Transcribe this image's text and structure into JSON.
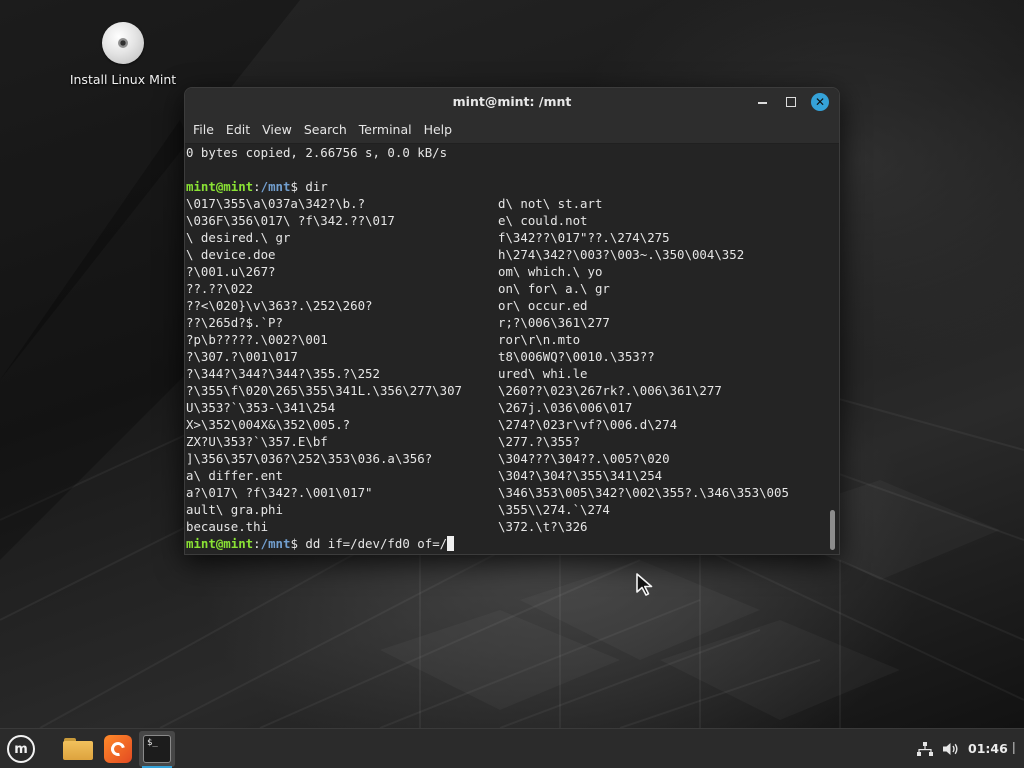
{
  "desktop": {
    "icons": [
      {
        "label": "Install Linux Mint",
        "icon": "disc-icon"
      }
    ]
  },
  "terminal": {
    "title": "mint@mint: /mnt",
    "window_buttons": {
      "minimize": "–",
      "maximize": "□",
      "close": "✕"
    },
    "menu": [
      "File",
      "Edit",
      "View",
      "Search",
      "Terminal",
      "Help"
    ],
    "first_line": "0 bytes copied, 2.66756 s, 0.0 kB/s",
    "prompt": {
      "user": "mint@mint",
      "sep": ":",
      "path": "/mnt",
      "symbol": "$ "
    },
    "dir_command": "dir",
    "listing": [
      [
        "\\017\\355\\a\\037a\\342?\\b.?",
        "d\\ not\\ st.art"
      ],
      [
        "\\036F\\356\\017\\ ?f\\342.??\\017",
        "e\\ could.not"
      ],
      [
        "\\ desired.\\ gr",
        "f\\342??\\017\"??.\\274\\275"
      ],
      [
        "\\ device.doe",
        "h\\274\\342?\\003?\\003~.\\350\\004\\352"
      ],
      [
        "?\\001.u\\267?",
        "om\\ which.\\ yo"
      ],
      [
        "??.??\\022",
        "on\\ for\\ a.\\ gr"
      ],
      [
        "??<\\020}\\v\\363?.\\252\\260?",
        "or\\ occur.ed"
      ],
      [
        "??\\265d?$.`P?",
        "r;?\\006\\361\\277"
      ],
      [
        "?p\\b?????.\\002?\\001",
        "ror\\r\\n.mto"
      ],
      [
        "?\\307.?\\001\\017",
        "t8\\006WQ?\\0010.\\353??"
      ],
      [
        "?\\344?\\344?\\344?\\355.?\\252",
        "ured\\ whi.le"
      ],
      [
        "?\\355\\f\\020\\265\\355\\341L.\\356\\277\\307",
        "\\260??\\023\\267rk?.\\006\\361\\277"
      ],
      [
        "U\\353?`\\353-\\341\\254",
        "\\267j.\\036\\006\\017"
      ],
      [
        "X>\\352\\004X&\\352\\005.?",
        "\\274?\\023r\\vf?\\006.d\\274"
      ],
      [
        "ZX?U\\353?`\\357.E\\bf",
        "\\277.?\\355?"
      ],
      [
        "]\\356\\357\\036?\\252\\353\\036.a\\356?",
        "\\304???\\304??.\\005?\\020"
      ],
      [
        "a\\ differ.ent",
        "\\304?\\304?\\355\\341\\254"
      ],
      [
        "a?\\017\\ ?f\\342?.\\001\\017\"",
        "\\346\\353\\005\\342?\\002\\355?.\\346\\353\\005"
      ],
      [
        "ault\\ gra.phi",
        "\\355\\\\274.`\\274"
      ],
      [
        "because.thi",
        "\\372.\\t?\\326"
      ]
    ],
    "current_command": "dd if=/dev/fd0 of=/"
  },
  "taskbar": {
    "launchers": [
      "mint-menu-icon",
      "files-icon",
      "firefox-icon",
      "terminal-icon"
    ],
    "terminal_icon_text": "$_",
    "tray": [
      "network-icon",
      "volume-icon"
    ],
    "clock": "01:46"
  },
  "colors": {
    "prompt_user": "#8ae234",
    "prompt_path": "#729fcf",
    "accent": "#35a2d8",
    "terminal_bg": "#242424"
  }
}
